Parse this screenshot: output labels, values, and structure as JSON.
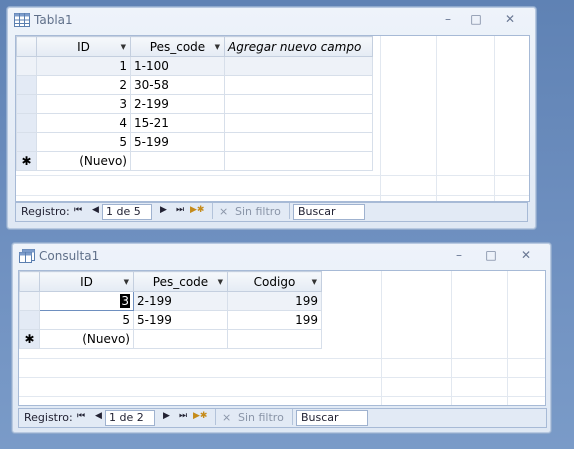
{
  "window1": {
    "title": "Tabla1",
    "minimize_label": "–",
    "restore_label": "□",
    "close_label": "✕",
    "columns": [
      "ID",
      "Pes_code",
      "Agregar nuevo campo"
    ],
    "rows": [
      {
        "id": "1",
        "pes_code": "1-100"
      },
      {
        "id": "2",
        "pes_code": "30-58"
      },
      {
        "id": "3",
        "pes_code": "2-199"
      },
      {
        "id": "4",
        "pes_code": "15-21"
      },
      {
        "id": "5",
        "pes_code": "5-199"
      }
    ],
    "new_row_marker": "✱",
    "new_row_label": "(Nuevo)",
    "nav": {
      "label": "Registro:",
      "first": "⏮",
      "prev": "◀",
      "record": "1 de 5",
      "next": "▶",
      "last": "⏭",
      "new": "▶✱",
      "filter_icon": "⨯",
      "filter": "Sin filtro",
      "search": "Buscar"
    }
  },
  "window2": {
    "title": "Consulta1",
    "minimize_label": "–",
    "restore_label": "□",
    "close_label": "✕",
    "columns": [
      "ID",
      "Pes_code",
      "Codigo"
    ],
    "rows": [
      {
        "id": "3",
        "pes_code": "2-199",
        "codigo": "199"
      },
      {
        "id": "5",
        "pes_code": "5-199",
        "codigo": "199"
      }
    ],
    "new_row_marker": "✱",
    "new_row_label": "(Nuevo)",
    "nav": {
      "label": "Registro:",
      "first": "⏮",
      "prev": "◀",
      "record": "1 de 2",
      "next": "▶",
      "last": "⏭",
      "new": "▶✱",
      "filter_icon": "⨯",
      "filter": "Sin filtro",
      "search": "Buscar"
    }
  }
}
